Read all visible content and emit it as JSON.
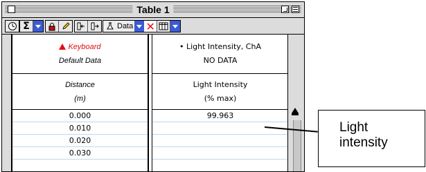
{
  "window": {
    "title": "Table 1"
  },
  "toolbar": {
    "data_menu_label": "Data"
  },
  "columns": [
    {
      "source": "Keyboard",
      "source_sub": "Default Data",
      "name": "Distance",
      "unit": "(m)",
      "rows": [
        "0.000",
        "0.010",
        "0.020",
        "0.030"
      ]
    },
    {
      "source": "• Light Intensity, ChA",
      "source_sub": "NO DATA",
      "name": "Light Intensity",
      "unit": "(% max)",
      "rows": [
        "99.963",
        "",
        "",
        ""
      ]
    }
  ],
  "callout": {
    "line1": "Light",
    "line2": "intensity"
  },
  "colors": {
    "accent_red": "#e01010",
    "menu_blue": "#3b5bd6",
    "row_divider": "#bcd9f2"
  },
  "icons": [
    "clock-icon",
    "sigma-icon",
    "lock-icon",
    "pencil-icon",
    "insert-left-icon",
    "insert-right-icon",
    "flask-icon",
    "delete-x-icon",
    "table-columns-icon"
  ]
}
